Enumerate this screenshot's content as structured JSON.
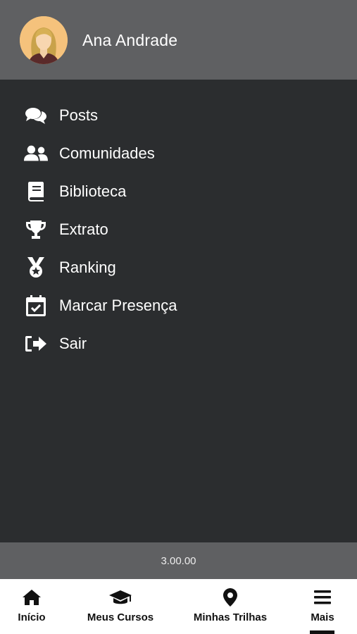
{
  "header": {
    "user_name": "Ana Andrade",
    "avatar_icon": "user-avatar"
  },
  "menu": {
    "items": [
      {
        "label": "Posts",
        "icon": "comments-icon"
      },
      {
        "label": "Comunidades",
        "icon": "users-icon"
      },
      {
        "label": "Biblioteca",
        "icon": "book-icon"
      },
      {
        "label": "Extrato",
        "icon": "trophy-icon"
      },
      {
        "label": "Ranking",
        "icon": "medal-icon"
      },
      {
        "label": "Marcar Presença",
        "icon": "calendar-check-icon"
      },
      {
        "label": "Sair",
        "icon": "sign-out-icon"
      }
    ]
  },
  "footer": {
    "version": "3.00.00"
  },
  "bottom_nav": {
    "items": [
      {
        "label": "Início",
        "icon": "home-icon"
      },
      {
        "label": "Meus Cursos",
        "icon": "graduation-cap-icon"
      },
      {
        "label": "Minhas Trilhas",
        "icon": "map-marker-icon"
      },
      {
        "label": "Mais",
        "icon": "menu-icon",
        "active": true
      }
    ]
  },
  "colors": {
    "header_bg": "#5f6062",
    "drawer_bg": "#2b2d2f",
    "bottom_nav_bg": "#ffffff",
    "text_light": "#ffffff",
    "text_dark": "#111111"
  }
}
